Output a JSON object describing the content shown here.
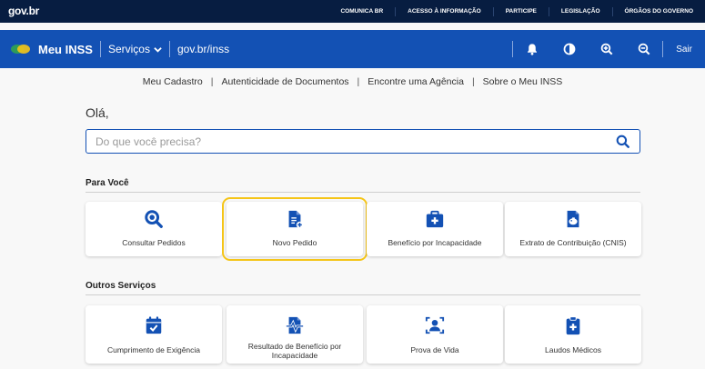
{
  "govbar": {
    "logo": "gov.br",
    "links": [
      "COMUNICA BR",
      "ACESSO À INFORMAÇÃO",
      "PARTICIPE",
      "LEGISLAÇÃO",
      "ÓRGÃOS DO GOVERNO"
    ]
  },
  "header": {
    "brand": "Meu INSS",
    "menu_label": "Serviços",
    "url": "gov.br/inss",
    "logout_label": "Sair"
  },
  "subnav": {
    "items": [
      "Meu Cadastro",
      "Autenticidade de Documentos",
      "Encontre uma Agência",
      "Sobre o Meu INSS"
    ]
  },
  "main": {
    "greeting": "Olá,",
    "search_placeholder": "Do que você precisa?",
    "sections": [
      {
        "title": "Para Você",
        "cards": [
          {
            "label": "Consultar Pedidos",
            "icon": "search-icon"
          },
          {
            "label": "Novo Pedido",
            "icon": "new-document-icon"
          },
          {
            "label": "Benefício por Incapacidade",
            "icon": "medical-kit-icon"
          },
          {
            "label": "Extrato de Contribuição (CNIS)",
            "icon": "piggy-bank-document-icon"
          }
        ]
      },
      {
        "title": "Outros Serviços",
        "cards": [
          {
            "label": "Cumprimento de Exigência",
            "icon": "calendar-check-icon"
          },
          {
            "label": "Resultado de Benefício por Incapacidade",
            "icon": "heartbeat-document-icon"
          },
          {
            "label": "Prova de Vida",
            "icon": "face-scan-icon"
          },
          {
            "label": "Laudos Médicos",
            "icon": "clipboard-medical-icon"
          }
        ]
      }
    ]
  },
  "colors": {
    "govbar_bg": "#071d41",
    "header_bg": "#1351b4",
    "icon_primary": "#1351b4",
    "highlight": "#f5c518"
  }
}
